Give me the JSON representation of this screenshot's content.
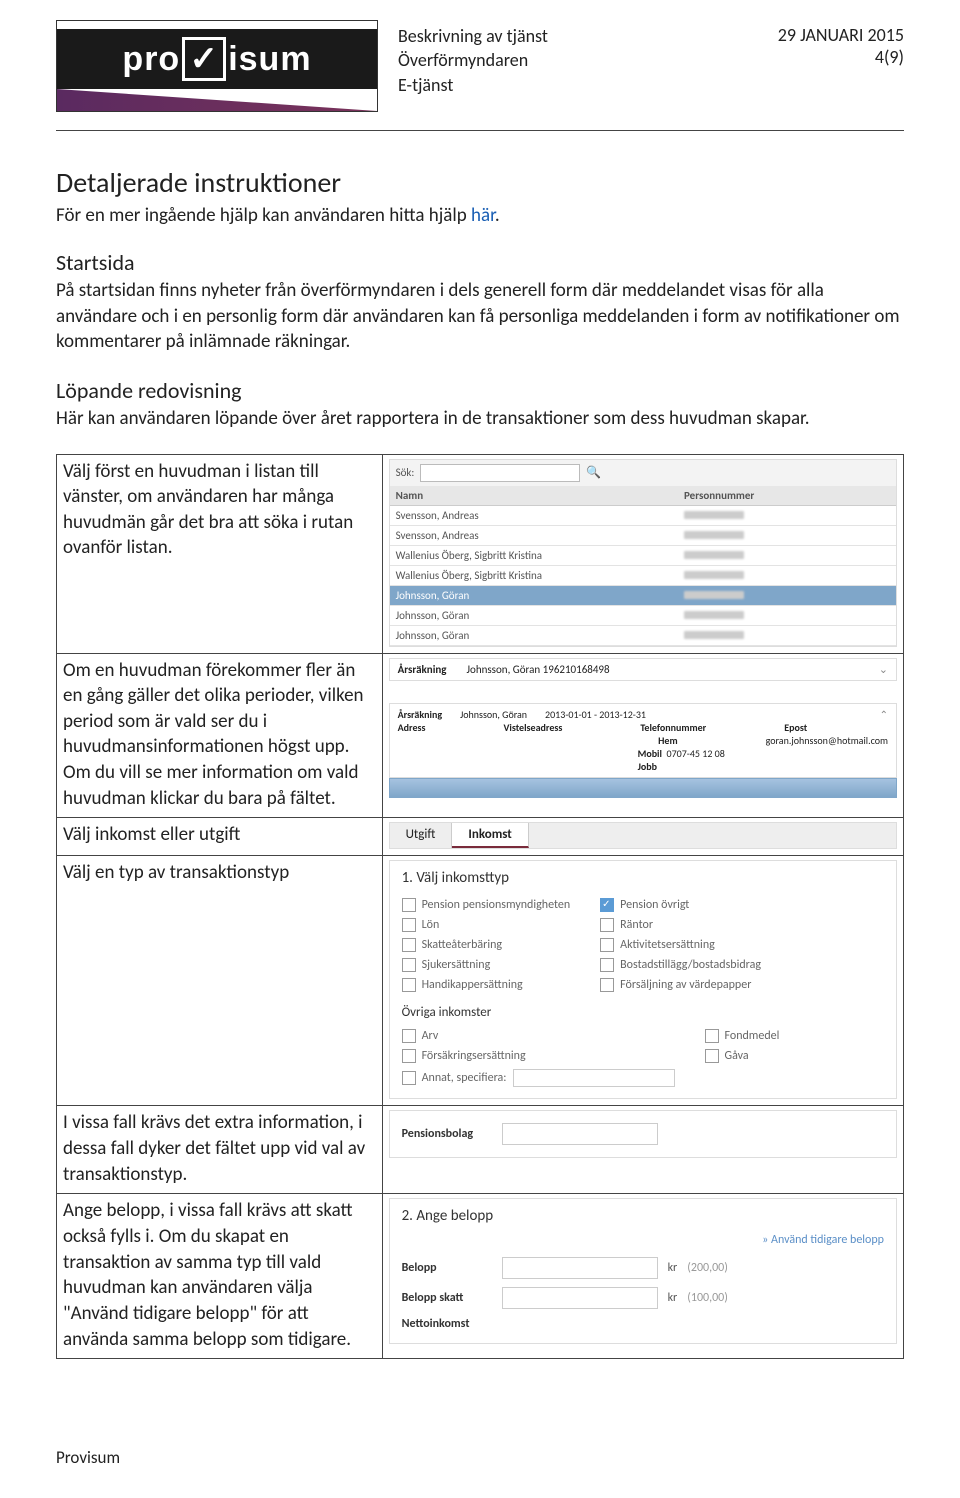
{
  "header": {
    "logo_text_left": "pro",
    "logo_text_mid": "✓",
    "logo_text_right": "isum",
    "doc_title": "Beskrivning av tjänst",
    "doc_subject": "Överförmyndaren",
    "doc_type": "E-tjänst",
    "date": "29 JANUARI 2015",
    "page": "4(9)"
  },
  "h1": "Detaljerade instruktioner",
  "lead_pre": "För en mer ingående hjälp kan användaren hitta hjälp ",
  "lead_link": "här",
  "lead_post": ".",
  "sec1_h": "Startsida",
  "sec1_p": "På startsidan finns nyheter från överförmyndaren i dels generell form där meddelandet visas för alla användare och i en personlig form där användaren kan få personliga meddelanden i form av notifikationer om kommentarer på inlämnade räkningar.",
  "sec2_h": "Löpande redovisning",
  "sec2_p": "Här kan användaren löpande över året rapportera in de transaktioner som dess huvudman skapar.",
  "rows": {
    "r1": "Välj först en huvudman i listan till vänster, om användaren har många huvudmän går det bra att söka i rutan ovanför listan.",
    "r2a": "Om en huvudman förekommer fler än en gång gäller det olika perioder, vilken period som är vald ser du i huvudmansinformationen högst upp.",
    "r2b": "Om du vill se mer information om vald huvudman klickar du bara på fältet.",
    "r3": "Välj inkomst eller utgift",
    "r4": "Välj en typ av transaktionstyp",
    "r5": "I vissa fall krävs det extra information, i dessa fall dyker det fältet upp vid val av transaktionstyp.",
    "r6": "Ange belopp, i vissa fall krävs att skatt också fylls i. Om du skapat en transaktion av samma typ till vald huvudman kan användaren välja \"Använd tidigare belopp\" för att använda samma belopp som tidigare."
  },
  "shot1": {
    "search_label": "Sök:",
    "col_name": "Namn",
    "col_pn": "Personnummer",
    "list": [
      "Svensson, Andreas",
      "Svensson, Andreas",
      "Wallenius Öberg, Sigbritt Kristina",
      "Wallenius Öberg, Sigbritt Kristina",
      "Johnsson, Göran",
      "Johnsson, Göran",
      "Johnsson, Göran"
    ],
    "selected_index": 4
  },
  "shot2": {
    "label": "Årsräkning",
    "name": "Johnsson, Göran 196210168498"
  },
  "shot3": {
    "label": "Årsräkning",
    "name": "Johnsson, Göran",
    "period": "2013-01-01 - 2013-12-31",
    "addr_l": "Adress",
    "addr2_l": "Vistelseadress",
    "tel_l": "Telefonnummer",
    "hem_l": "Hem",
    "mob_l": "Mobil",
    "mob_v": "0707-45 12 08",
    "jobb_l": "Jobb",
    "ep_l": "Epost",
    "ep_v": "goran.johnsson@hotmail.com"
  },
  "tabs": {
    "utgift": "Utgift",
    "inkomst": "Inkomst"
  },
  "shot4": {
    "heading": "1. Välj inkomsttyp",
    "left": [
      "Pension pensionsmyndigheten",
      "Lön",
      "Skatteåterbäring",
      "Sjukersättning",
      "Handikappersättning"
    ],
    "right": [
      "Pension övrigt",
      "Räntor",
      "Aktivitetsersättning",
      "Bostadstillägg/bostadsbidrag",
      "Försäljning av värdepapper"
    ],
    "right_checked_index": 0,
    "sub": "Övriga inkomster",
    "sub_left": [
      "Arv",
      "Försäkringsersättning",
      "Annat, specifiera:"
    ],
    "sub_right": [
      "Fondmedel",
      "Gåva"
    ]
  },
  "shot5": {
    "label": "Pensionsbolag"
  },
  "shot6": {
    "heading": "2. Ange belopp",
    "link": "» Använd tidigare belopp",
    "belopp_l": "Belopp",
    "belopp_unit": "kr",
    "belopp_hint": "(200,00)",
    "skatt_l": "Belopp skatt",
    "skatt_unit": "kr",
    "skatt_hint": "(100,00)",
    "netto_l": "Nettoinkomst"
  },
  "footer": "Provisum"
}
